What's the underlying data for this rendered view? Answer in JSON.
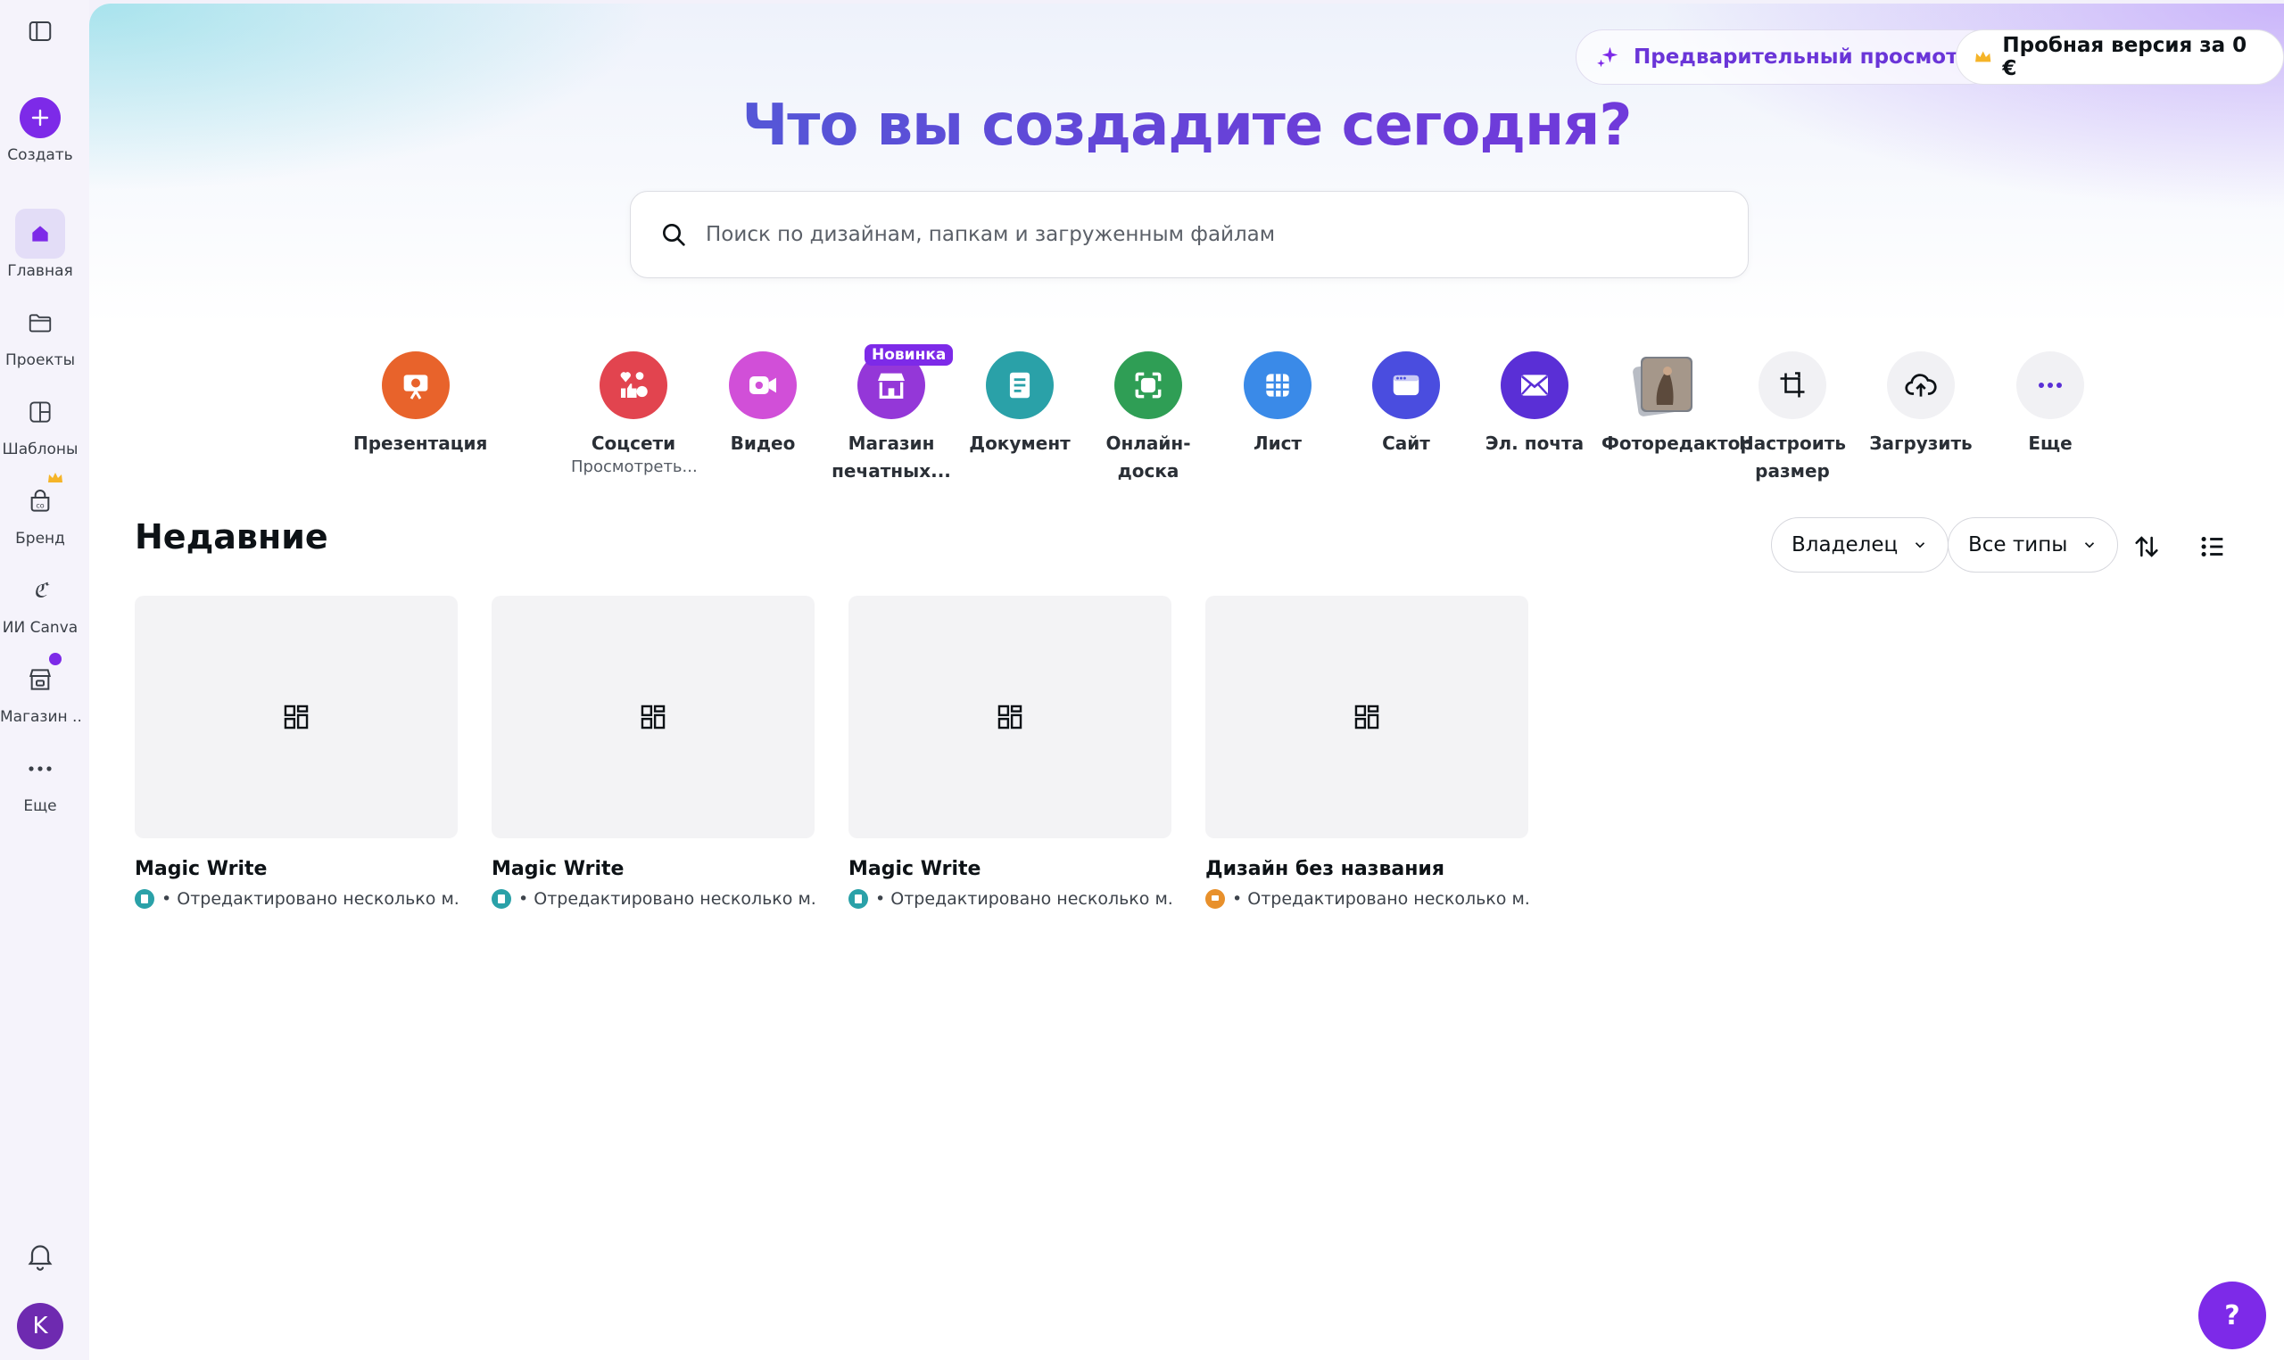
{
  "sidebar": {
    "create_label": "Создать",
    "items": [
      {
        "label": "Главная"
      },
      {
        "label": "Проекты"
      },
      {
        "label": "Шаблоны"
      },
      {
        "label": "Бренд"
      },
      {
        "label": "ИИ Canva"
      },
      {
        "label": "Магазин ..."
      },
      {
        "label": "Еще"
      }
    ],
    "avatar_initial": "K"
  },
  "header": {
    "preview_label": "Предварительный просмотр",
    "trial_label": "Пробная версия за 0 €",
    "title": "Что вы создадите сегодня?"
  },
  "search": {
    "placeholder": "Поиск по дизайнам, папкам и загруженным файлам"
  },
  "tiles": [
    {
      "label": "Презентация",
      "sub": "",
      "color": "#e8632b"
    },
    {
      "label": "Соцсети",
      "sub": "Просмотреть...",
      "color": "#e2444f"
    },
    {
      "label": "Видео",
      "sub": "",
      "color": "#d14fd8"
    },
    {
      "label": "Магазин печатных...",
      "sub": "",
      "color": "#9437d8",
      "badge": "Новинка"
    },
    {
      "label": "Документ",
      "sub": "",
      "color": "#2aa1a8"
    },
    {
      "label": "Онлайн-доска",
      "sub": "",
      "color": "#2f9e55"
    },
    {
      "label": "Лист",
      "sub": "",
      "color": "#3a8ae8"
    },
    {
      "label": "Сайт",
      "sub": "",
      "color": "#4a4ddf"
    },
    {
      "label": "Эл. почта",
      "sub": "",
      "color": "#5a2fd6"
    },
    {
      "label": "Фоторедактор",
      "sub": "",
      "color": "#8a8a8a"
    },
    {
      "label": "Настроить размер",
      "sub": "",
      "color": "#f1f1f4"
    },
    {
      "label": "Загрузить",
      "sub": "",
      "color": "#f1f1f4"
    },
    {
      "label": "Еще",
      "sub": "",
      "color": "#f1f1f4"
    }
  ],
  "recents": {
    "title": "Недавние",
    "owner_filter": "Владелец",
    "type_filter": "Все типы",
    "cards": [
      {
        "title": "Magic Write",
        "meta": "• Отредактировано несколько м...",
        "icon_color": "#2aa1a8"
      },
      {
        "title": "Magic Write",
        "meta": "• Отредактировано несколько м...",
        "icon_color": "#2aa1a8"
      },
      {
        "title": "Magic Write",
        "meta": "• Отредактировано несколько м...",
        "icon_color": "#2aa1a8"
      },
      {
        "title": "Дизайн без названия",
        "meta": "• Отредактировано несколько м...",
        "icon_color": "#e8902b"
      }
    ]
  },
  "help_label": "?"
}
